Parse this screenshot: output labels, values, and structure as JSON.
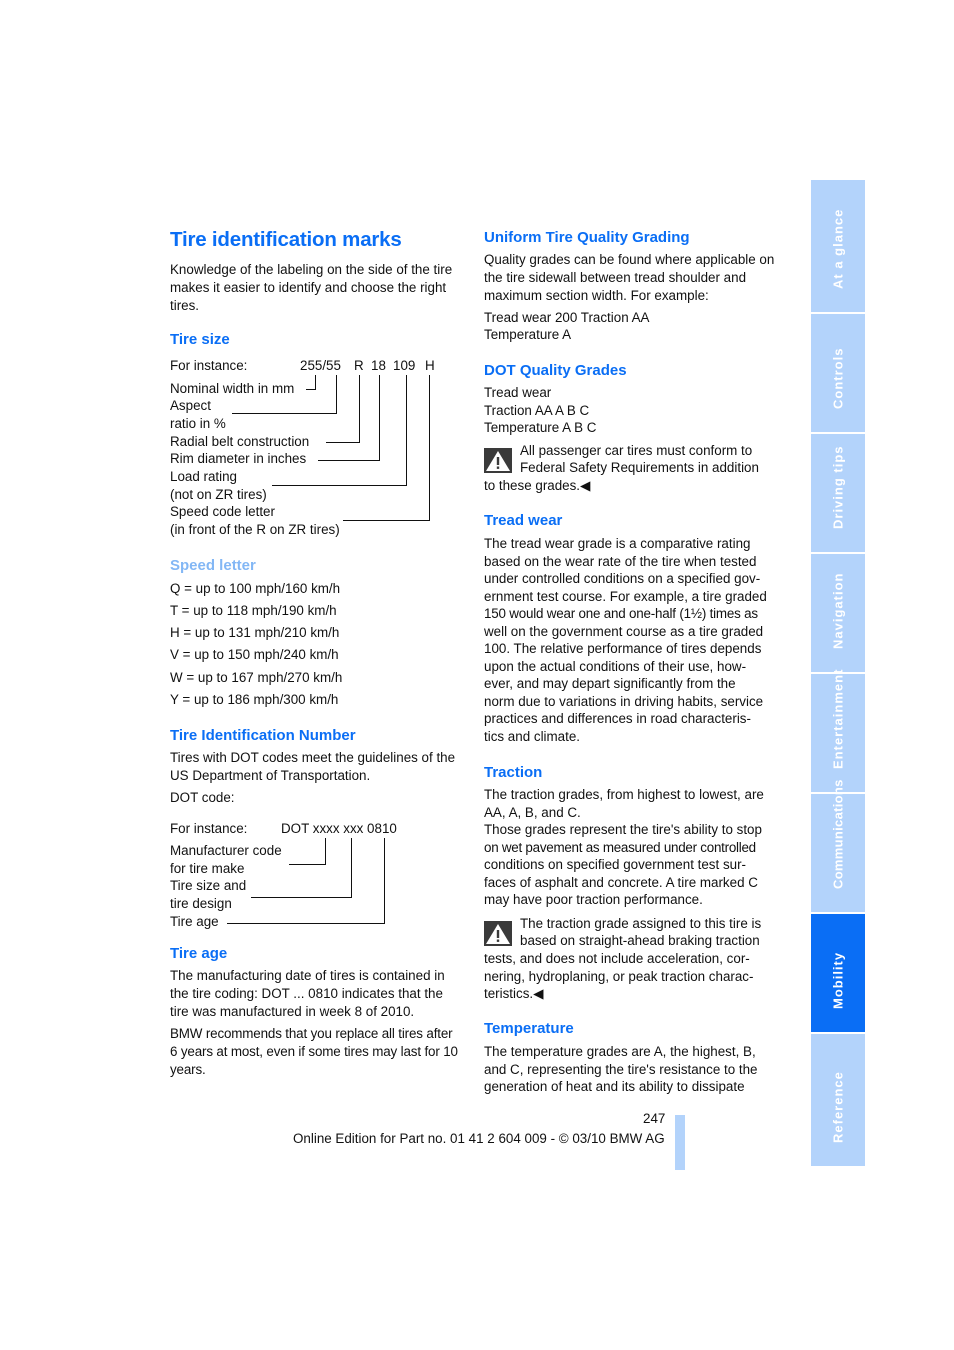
{
  "title": "Tire identification marks",
  "intro": "Knowledge of the labeling on the side of the tire makes it easier to identify and choose the right tires.",
  "tire_size": {
    "heading": "Tire size",
    "for_instance_label": "For instance:",
    "code_parts": [
      "255/55",
      "R",
      "18",
      "109",
      "H"
    ],
    "labels": [
      "Nominal width in mm",
      "Aspect",
      "ratio in %",
      "Radial belt construction",
      "Rim diameter in inches",
      "Load rating",
      "(not on ZR tires)",
      "Speed code letter",
      "(in front of the R on ZR tires)"
    ]
  },
  "speed_letter": {
    "heading": "Speed letter",
    "items": [
      "Q = up to 100 mph/160 km/h",
      "T = up to 118 mph/190 km/h",
      "H = up to 131 mph/210 km/h",
      "V = up to 150 mph/240 km/h",
      "W = up to 167 mph/270 km/h",
      "Y = up to 186 mph/300 km/h"
    ]
  },
  "tin": {
    "heading": "Tire Identification Number",
    "text": "Tires with DOT codes meet the guidelines of the US Department of Transportation.",
    "dot_code_label": "DOT code:",
    "for_instance_label": "For instance:",
    "code": "DOT xxxx xxx 0810",
    "labels": [
      "Manufacturer code",
      "for tire make",
      "Tire size and",
      "tire design",
      "Tire age"
    ]
  },
  "tire_age": {
    "heading": "Tire age",
    "p1": "The manufacturing date of tires is contained in the tire coding: DOT ... 0810 indicates that the tire was manufactured in week 8 of 2010.",
    "p2": "BMW recommends that you replace all tires after 6 years at most, even if some tires may last for 10 years."
  },
  "utqg": {
    "heading": "Uniform Tire Quality Grading",
    "text": "Quality grades can be found where applicable on the tire sidewall between tread shoulder and maximum section width. For example:",
    "example_line1": "Tread wear 200 Traction AA",
    "example_line2": "Temperature A"
  },
  "dot_grades": {
    "heading": "DOT Quality Grades",
    "lines": [
      "Tread wear",
      "Traction AA A B C",
      "Temperature A B C"
    ],
    "warning_line1": "All passenger car tires must conform to",
    "warning_line2": "Federal Safety Requirements in addition",
    "warning_line3": "to these grades.◀"
  },
  "tread_wear": {
    "heading": "Tread wear",
    "lines": [
      "The tread wear grade is a comparative rating",
      "based on the wear rate of the tire when tested",
      "under controlled conditions on a specified gov-",
      "ernment test course. For example, a tire graded",
      "150 would wear one and one-half (1½) times as",
      "well on the government course as a tire graded",
      "100. The relative performance of tires depends",
      "upon the actual conditions of their use, how-",
      "ever, and may depart significantly from the",
      "norm due to variations in driving habits, service",
      "practices and differences in road characteris-",
      "tics and climate."
    ]
  },
  "traction": {
    "heading": "Traction",
    "lines": [
      "The traction grades, from highest to lowest, are",
      "AA, A, B, and C.",
      "Those grades represent the tire's ability to stop",
      "on wet pavement as measured under controlled",
      "conditions on specified government test sur-",
      "faces of asphalt and concrete. A tire marked C",
      "may have poor traction performance."
    ],
    "warning_lines": [
      "The traction grade assigned to this tire is",
      "based on straight-ahead braking traction",
      "tests, and does not include acceleration, cor-",
      "nering, hydroplaning, or peak traction charac-",
      "teristics.◀"
    ]
  },
  "temperature": {
    "heading": "Temperature",
    "lines": [
      "The temperature grades are A, the highest, B,",
      "and C, representing the tire's resistance to the",
      "generation of heat and its ability to dissipate"
    ]
  },
  "footer": {
    "page_number": "247",
    "edition": "Online Edition for Part no. 01 41 2 604 009 - © 03/10 BMW AG"
  },
  "side_tabs": [
    {
      "label": "At a glance",
      "active": false
    },
    {
      "label": "Controls",
      "active": false
    },
    {
      "label": "Driving tips",
      "active": false
    },
    {
      "label": "Navigation",
      "active": false
    },
    {
      "label": "Entertainment",
      "active": false
    },
    {
      "label": "Communications",
      "active": false
    },
    {
      "label": "Mobility",
      "active": true
    },
    {
      "label": "Reference",
      "active": false
    }
  ],
  "colors": {
    "heading_blue": "#0a6ef5",
    "light_blue_heading": "#83b7f5",
    "tab_inactive": "#b3d3fb",
    "tab_active": "#0a6ef5"
  }
}
